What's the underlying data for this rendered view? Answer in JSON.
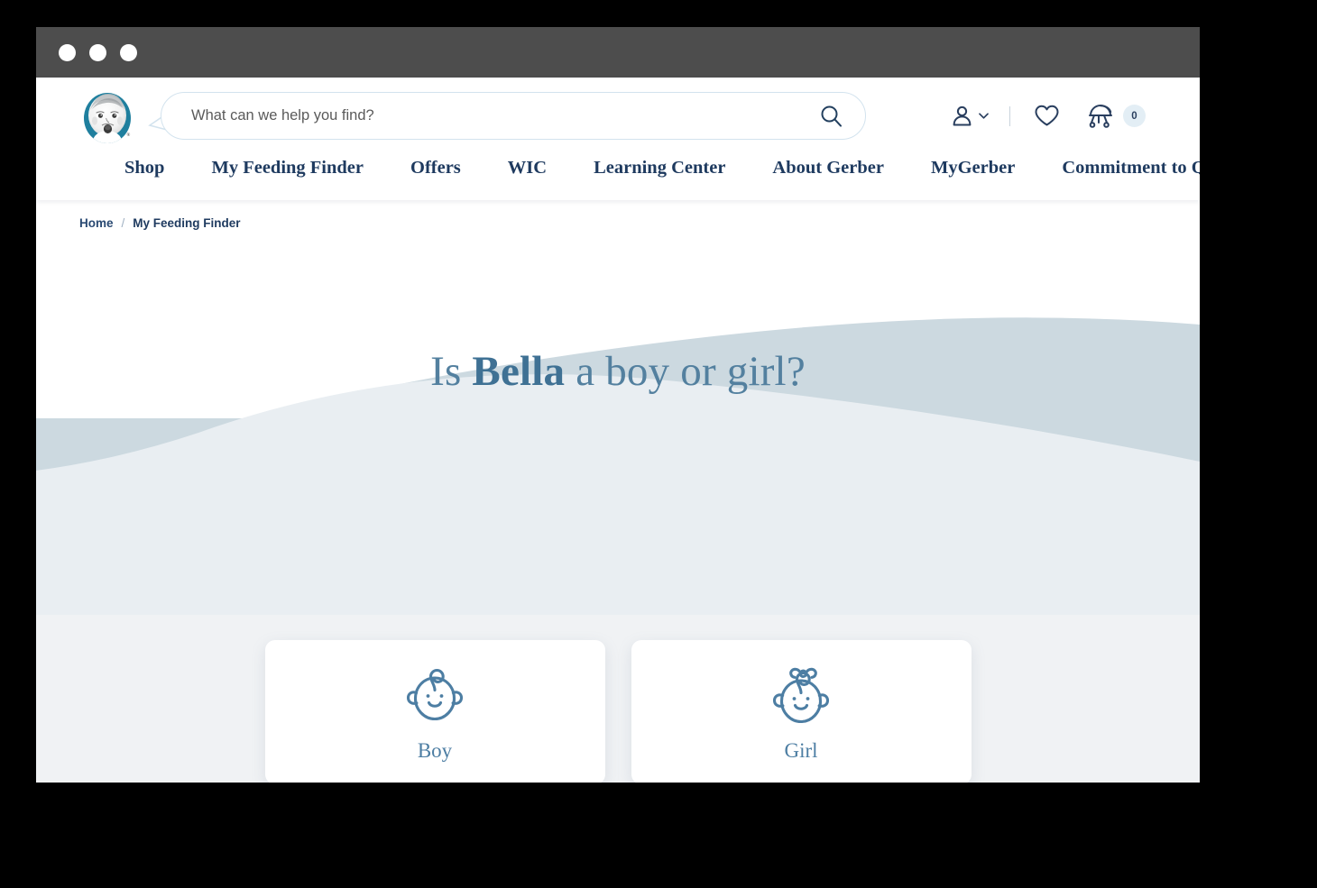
{
  "window": {
    "title_bar_color": "#4d4d4d",
    "dots": [
      "window-dot-1",
      "window-dot-2",
      "window-dot-3"
    ]
  },
  "header": {
    "logo_alt": "Gerber baby logo",
    "search": {
      "placeholder": "What can we help you find?",
      "value": "",
      "icon": "search-icon"
    },
    "actions": {
      "account": {
        "icon": "user-icon",
        "chevron": "chevron-down-icon"
      },
      "wishlist": {
        "icon": "heart-icon"
      },
      "cart": {
        "icon": "stroller-icon",
        "count": "0"
      }
    }
  },
  "nav": {
    "items": [
      {
        "label": "Shop"
      },
      {
        "label": "My Feeding Finder"
      },
      {
        "label": "Offers"
      },
      {
        "label": "WIC"
      },
      {
        "label": "Learning Center"
      },
      {
        "label": "About Gerber"
      },
      {
        "label": "MyGerber"
      },
      {
        "label": "Commitment to Quality"
      }
    ]
  },
  "breadcrumb": {
    "home": "Home",
    "separator": "/",
    "current": "My Feeding Finder"
  },
  "main": {
    "headline": {
      "prefix": "Is",
      "name": "Bella",
      "suffix": "a boy or girl?"
    },
    "choices": [
      {
        "label": "Boy",
        "icon": "baby-boy-face-icon"
      },
      {
        "label": "Girl",
        "icon": "baby-girl-face-icon"
      }
    ]
  },
  "colors": {
    "brand_navy": "#1e3a5f",
    "headline_blue": "#53809f",
    "icon_blue": "#4d7ea3",
    "wave_dark": "#ccd9e0",
    "wave_light": "#e9eef2",
    "page_bg": "#f0f2f4",
    "title_bar": "#4d4d4d",
    "badge_bg": "#e3eef5"
  }
}
